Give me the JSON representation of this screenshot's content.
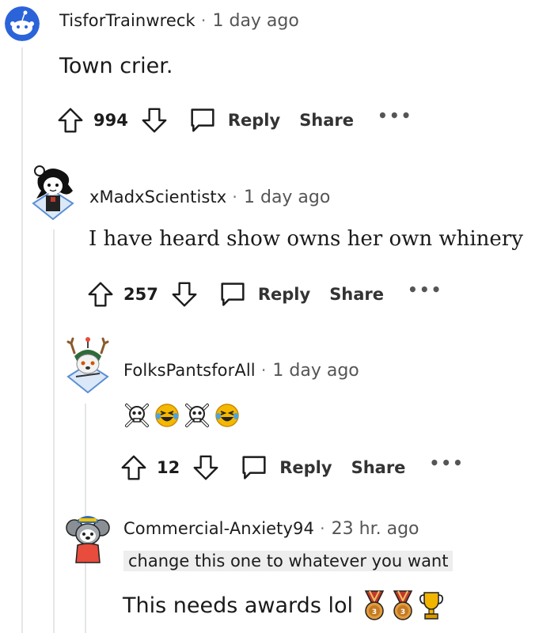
{
  "comments": [
    {
      "username": "TisforTrainwreck",
      "time": "1 day ago",
      "body": "Town crier.",
      "votes": "994",
      "reply_label": "Reply",
      "share_label": "Share",
      "more_label": "•••"
    },
    {
      "username": "xMadxScientistx",
      "time": "1 day ago",
      "body": "I have heard show owns her own whinery",
      "votes": "257",
      "reply_label": "Reply",
      "share_label": "Share",
      "more_label": "•••"
    },
    {
      "username": "FolksPantsforAll",
      "time": "1 day ago",
      "body_emojis": [
        "skull-crossbones",
        "laughing-face",
        "skull-crossbones",
        "laughing-face"
      ],
      "votes": "12",
      "reply_label": "Reply",
      "share_label": "Share",
      "more_label": "•••"
    },
    {
      "username": "Commercial-Anxiety94",
      "time": "23 hr. ago",
      "flair": "change this one to whatever you want",
      "body": "This needs awards lol",
      "awards": [
        "bronze-medal",
        "bronze-medal",
        "gold-trophy"
      ]
    }
  ],
  "separator": "·",
  "colors": {
    "text": "#1c1c1c",
    "muted": "#555555",
    "thread_line": "#e4e6e8",
    "snoo_blue": "#2b63d9",
    "flair_bg": "#eeeeee"
  }
}
